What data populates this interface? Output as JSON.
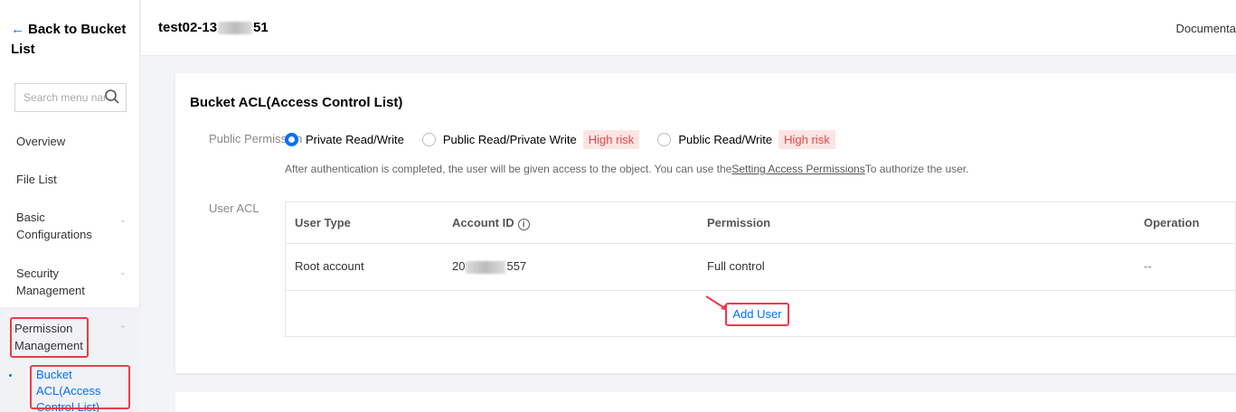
{
  "sidebar": {
    "back_label": "Back to Bucket List",
    "search_placeholder": "Search menu nam",
    "items": [
      {
        "label": "Overview"
      },
      {
        "label": "File List"
      },
      {
        "label": "Basic Configurations"
      },
      {
        "label": "Security Management"
      },
      {
        "label": "Permission Management"
      }
    ],
    "sub_item": "Bucket ACL(Access Control List)"
  },
  "header": {
    "bucket_prefix": "test02-13",
    "bucket_suffix": "51",
    "doc_link": "Documenta"
  },
  "acl": {
    "title": "Bucket ACL(Access Control List)",
    "public_label": "Public Permission",
    "options": [
      {
        "label": "Private Read/Write",
        "selected": true
      },
      {
        "label": "Public Read/Private Write",
        "risk": "High risk"
      },
      {
        "label": "Public Read/Write",
        "risk": "High risk"
      }
    ],
    "hint_before": "After authentication is completed, the user will be given access to the object. You can use the",
    "hint_link": "Setting Access Permissions",
    "hint_after": "To authorize the user.",
    "user_acl_label": "User ACL",
    "table": {
      "columns": [
        "User Type",
        "Account ID",
        "Permission",
        "Operation"
      ],
      "rows": [
        {
          "user_type": "Root account",
          "account_prefix": "20",
          "account_suffix": "557",
          "permission": "Full control",
          "operation": "--"
        }
      ]
    },
    "add_user": "Add User"
  },
  "colors": {
    "accent": "#006eff",
    "highlight": "#ee3a4b",
    "risk_bg": "#fde4e4",
    "risk_text": "#e54545"
  }
}
